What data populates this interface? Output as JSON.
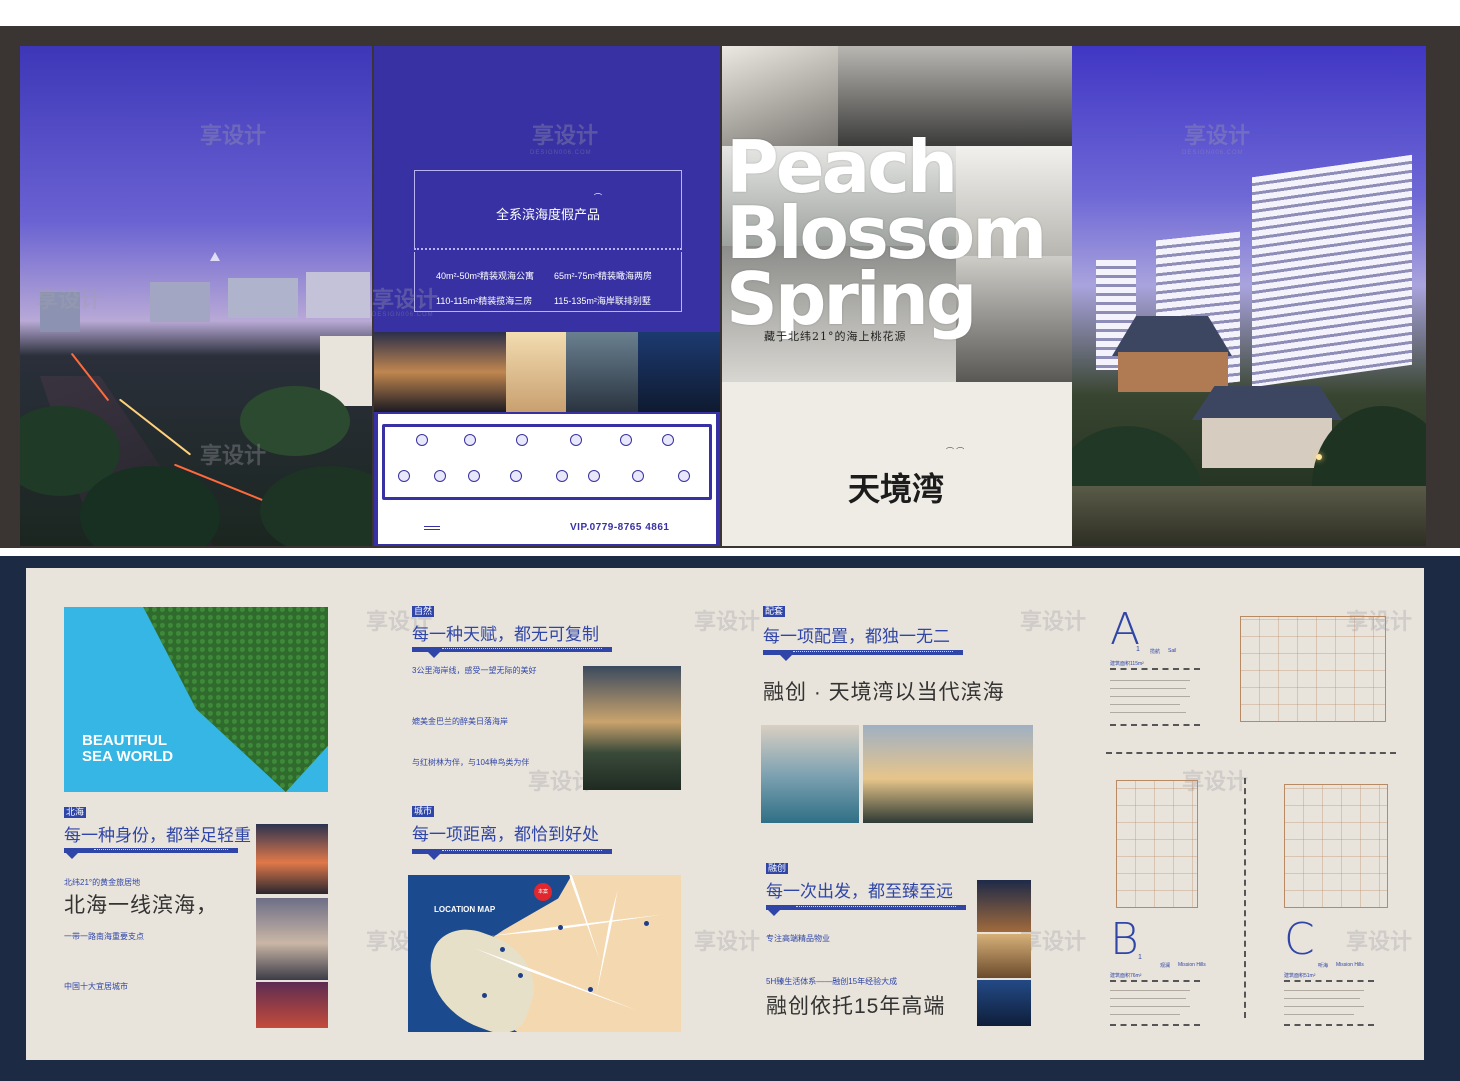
{
  "panel1": {
    "text_lines": [
      "",
      "",
      "",
      ""
    ],
    "brand_line": ""
  },
  "panel2": {
    "title": "全系滨海度假产品",
    "subtitle": "",
    "specs": [
      "40m²-50m²精装观海公寓",
      "65m²-75m²精装瞰海两房",
      "110-115m²精装揽海三房",
      "115-135m²海岸联排别墅"
    ],
    "icons": [
      {
        "icon": "building-icon",
        "label": ""
      },
      {
        "icon": "runner-icon",
        "label": ""
      },
      {
        "icon": "spa-icon",
        "label": ""
      },
      {
        "icon": "car-icon",
        "label": ""
      },
      {
        "icon": "headset-icon",
        "label": ""
      },
      {
        "icon": "bell-icon",
        "label": ""
      },
      {
        "icon": "sofa-icon",
        "label": ""
      },
      {
        "icon": "hiker-icon",
        "label": ""
      },
      {
        "icon": "tree-icon",
        "label": ""
      },
      {
        "icon": "ship-icon",
        "label": ""
      },
      {
        "icon": "park-icon",
        "label": ""
      },
      {
        "icon": "chair-icon",
        "label": ""
      },
      {
        "icon": "food-icon",
        "label": ""
      },
      {
        "icon": "flag-icon",
        "label": ""
      }
    ],
    "footer_address": "",
    "phone": "VIP.0779-8765 4861"
  },
  "panel3": {
    "headline": [
      "Peach",
      "Blossom",
      "Spring"
    ],
    "caption": "藏于北纬21°的海上桃花源",
    "brand": "天境湾",
    "brand_sub": ""
  },
  "watermark": {
    "cn": "享设计",
    "en": "DESIGN006.COM"
  },
  "bottom": {
    "sea_title": [
      "BEAUTIFUL",
      "SEA WORLD"
    ],
    "section_beihai": {
      "tag": "北海",
      "heading": "每一种身份，都举足轻重",
      "line1": "北纬21°的黄金旅居地",
      "big": "北海一线滨海，",
      "line2": "一带一路南海重要支点",
      "line3": "中国十大宜居城市"
    },
    "section_nature": {
      "tag": "自然",
      "heading": "每一种天赋，都无可复制",
      "lines": [
        "3公里海岸线，感受一望无际的美好",
        "媲美金巴兰的醉美日落海岸",
        "与红树林为伴，与104种鸟类为伴"
      ]
    },
    "section_city": {
      "tag": "城市",
      "heading": "每一项距离，都恰到好处",
      "map_title": "LOCATION MAP",
      "pin": "本案"
    },
    "section_config": {
      "tag": "配套",
      "heading": "每一项配置，都独一无二",
      "big": "融创 · 天境湾以当代滨海"
    },
    "section_sunac": {
      "tag": "融创",
      "heading": "每一次出发，都至臻至远",
      "line1": "专注高端精品物业",
      "line2": "5H臻生活体系——融创15年经验大成",
      "big": "融创依托15年高端"
    },
    "floorplans": [
      {
        "letter": "A",
        "index": "1",
        "name": "揽航",
        "name_en": "Sail",
        "area": "建筑面积115m²"
      },
      {
        "letter": "B",
        "index": "1",
        "name": "观澜",
        "name_en": "Mission Hills",
        "area": "建筑面积76m²"
      },
      {
        "letter": "C",
        "index": "",
        "name": "听海",
        "name_en": "Mission Hills",
        "area": "建筑面积51m²"
      }
    ]
  },
  "colors": {
    "brand_blue": "#3731a3",
    "text_blue": "#2f46a8",
    "beige": "#e9e4db",
    "frame_dark": "#3a3433"
  }
}
